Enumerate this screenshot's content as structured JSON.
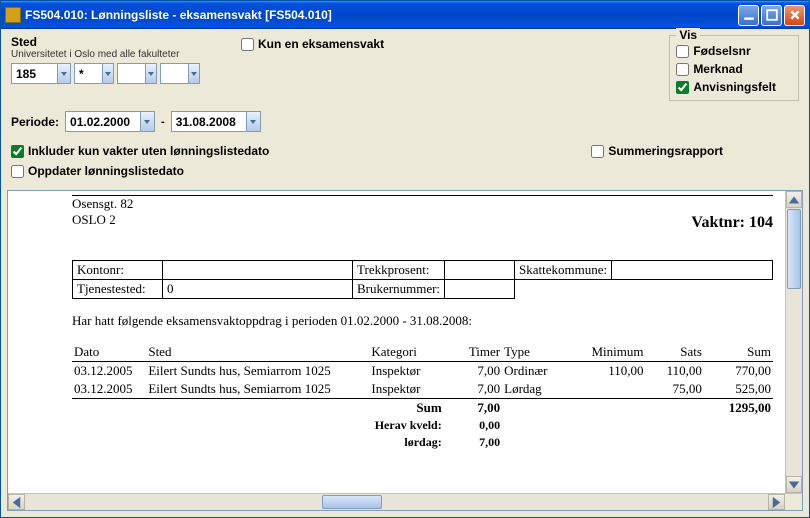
{
  "titlebar": "FS504.010: Lønningsliste - eksamensvakt  [FS504.010]",
  "sted": {
    "label": "Sted",
    "sub": "Universitetet i Oslo med alle fakulteter",
    "v1": "185",
    "v2": "*",
    "v3": "",
    "v4": ""
  },
  "kun_en": "Kun en eksamensvakt",
  "vis": {
    "title": "Vis",
    "fodselsnr": "Fødselsnr",
    "merknad": "Merknad",
    "anvisningsfelt": "Anvisningsfelt"
  },
  "periode": {
    "label": "Periode:",
    "from": "01.02.2000",
    "to": "31.08.2008"
  },
  "inkluder": "Inkluder kun vakter uten lønningslistedato",
  "summering": "Summeringsrapport",
  "oppdater": "Oppdater lønningslistedato",
  "report": {
    "addr1": "Osensgt. 82",
    "addr2": "OSLO 2",
    "vaktnr_label": "Vaktnr:",
    "vaktnr": "104",
    "kontonr_lbl": "Kontonr:",
    "kontonr": "",
    "trekkprosent_lbl": "Trekkprosent:",
    "trekkprosent": "",
    "skattekommune_lbl": "Skattekommune:",
    "skattekommune": "",
    "tjenestested_lbl": "Tjenestested:",
    "tjenestested": "0",
    "brukernummer_lbl": "Brukernummer:",
    "brukernummer": "",
    "period_text": "Har hatt følgende eksamensvaktoppdrag i perioden 01.02.2000 - 31.08.2008:",
    "headers": {
      "dato": "Dato",
      "sted": "Sted",
      "kategori": "Kategori",
      "timer": "Timer",
      "type": "Type",
      "minimum": "Minimum",
      "sats": "Sats",
      "sum": "Sum"
    },
    "rows": [
      {
        "dato": "03.12.2005",
        "sted": "Eilert Sundts hus, Semiarrom 1025",
        "kategori": "Inspektør",
        "timer": "7,00",
        "type": "Ordinær",
        "minimum": "110,00",
        "sats": "110,00",
        "sum": "770,00"
      },
      {
        "dato": "03.12.2005",
        "sted": "Eilert Sundts hus, Semiarrom 1025",
        "kategori": "Inspektør",
        "timer": "7,00",
        "type": "Lørdag",
        "minimum": "",
        "sats": "75,00",
        "sum": "525,00"
      }
    ],
    "sum_lbl": "Sum",
    "sum_timer": "7,00",
    "sum_total": "1295,00",
    "herav_kveld_lbl": "Herav kveld:",
    "herav_kveld": "0,00",
    "lordag_lbl": "lørdag:",
    "lordag": "7,00"
  }
}
